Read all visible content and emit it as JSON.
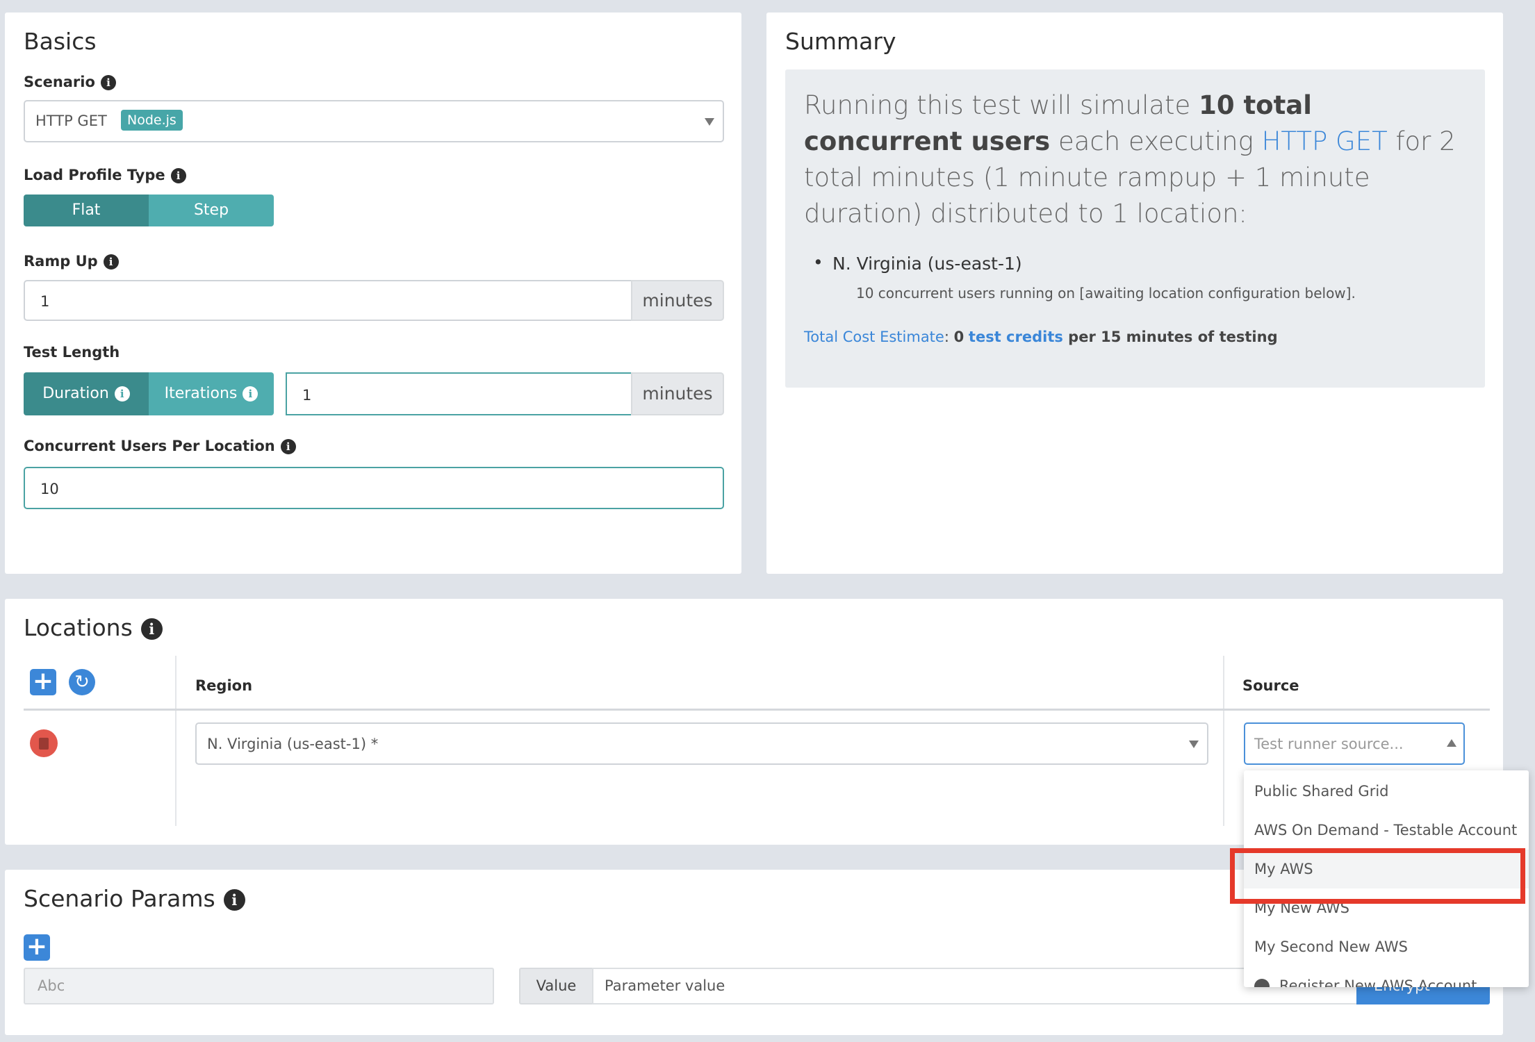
{
  "basics": {
    "title": "Basics",
    "scenario_label": "Scenario",
    "scenario_value": "HTTP GET",
    "scenario_badge": "Node.js",
    "load_profile_label": "Load Profile Type",
    "profile_flat": "Flat",
    "profile_step": "Step",
    "ramp_up_label": "Ramp Up",
    "ramp_up_value": "1",
    "ramp_up_unit": "minutes",
    "test_length_label": "Test Length",
    "duration_label": "Duration",
    "iterations_label": "Iterations",
    "test_length_value": "1",
    "test_length_unit": "minutes",
    "concurrent_label": "Concurrent Users Per Location",
    "concurrent_value": "10"
  },
  "summary": {
    "title": "Summary",
    "t1": "Running this test will simulate ",
    "t2": "10 total concurrent users",
    "t3": " each executing ",
    "t4": "HTTP GET",
    "t5": " for 2 total minutes (1 minute rampup + 1 minute duration) distributed to 1 location:",
    "location_name": "N. Virginia (us-east-1)",
    "location_detail": "10 concurrent users running on [awaiting location configuration below].",
    "cost_label": "Total Cost Estimate",
    "cost_sep": ": ",
    "cost_value": "0",
    "cost_unit": "test credits",
    "cost_suffix": " per 15 minutes of testing"
  },
  "locations": {
    "title": "Locations",
    "col_region": "Region",
    "col_source": "Source",
    "region_value": "N. Virginia (us-east-1) *",
    "source_placeholder": "Test runner source...",
    "options": [
      "Public Shared Grid",
      "AWS On Demand - Testable Account",
      "My AWS",
      "My New AWS",
      "My Second New AWS",
      "Register New AWS Account"
    ]
  },
  "params": {
    "title": "Scenario Params",
    "name_placeholder": "Abc",
    "value_label": "Value",
    "value_placeholder": "Parameter value",
    "encrypt_label": "Encrypt"
  },
  "colors": {
    "teal_dark": "#3b8b8c",
    "teal_light": "#4fadaf",
    "blue": "#3c87d8",
    "red": "#e5392a",
    "trash_red": "#e2574c"
  }
}
